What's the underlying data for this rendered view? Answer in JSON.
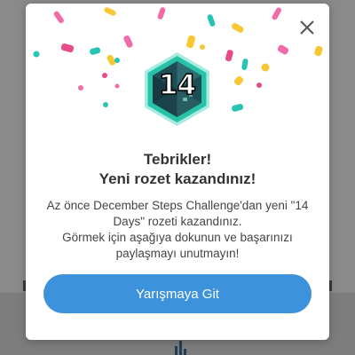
{
  "dialog": {
    "close_icon": "close-icon",
    "badge": {
      "number": "14",
      "icon": "hexagon-badge-icon"
    },
    "title_line1": "Tebrikler!",
    "title_line2": "Yeni rozet kazandınız!",
    "message_lines": [
      "Az önce December Steps Challenge'dan yeni \"14",
      "Days\" rozeti kazandınız.",
      "Görmek için aşağıya dokunun ve başarınızı",
      "paylaşmayı unutmayın!"
    ],
    "cta_label": "Yarışmaya Git"
  },
  "colors": {
    "accent": "#3c93db",
    "badge_teal": "#27c3a9",
    "confetti": [
      "#f06ba8",
      "#f7c833",
      "#26c4b4",
      "#e84a8a"
    ]
  }
}
